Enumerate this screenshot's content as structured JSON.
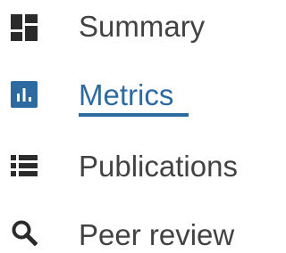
{
  "nav": {
    "accent_color": "#2d6aa0",
    "text_color": "#424242",
    "items": [
      {
        "label": "Summary",
        "icon": "dashboard-icon",
        "active": false
      },
      {
        "label": "Metrics",
        "icon": "bar-chart-icon",
        "active": true
      },
      {
        "label": "Publications",
        "icon": "list-icon",
        "active": false
      },
      {
        "label": "Peer review",
        "icon": "search-icon",
        "active": false
      }
    ]
  }
}
